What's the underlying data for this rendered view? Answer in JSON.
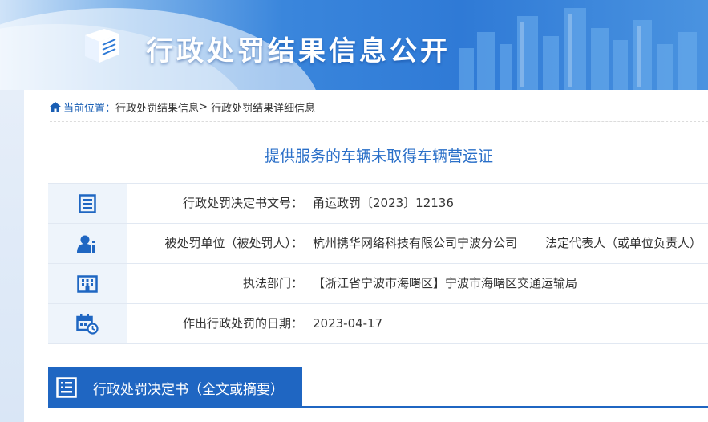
{
  "banner": {
    "title": "行政处罚结果信息公开"
  },
  "breadcrumb": {
    "label": "当前位置：",
    "items": [
      "行政处罚结果信息",
      "行政处罚结果详细信息"
    ],
    "separator": ">"
  },
  "page_title": "提供服务的车辆未取得车辆营运证",
  "rows": [
    {
      "icon": "document-icon",
      "label": "行政处罚决定书文号：",
      "value": "甬运政罚〔2023〕12136"
    },
    {
      "icon": "person-info-icon",
      "label": "被处罚单位（被处罚人）：",
      "value": "杭州携华网络科技有限公司宁波分公司",
      "extra": "法定代表人（或单位负责人）"
    },
    {
      "icon": "building-icon",
      "label": "执法部门：",
      "value": "【浙江省宁波市海曙区】宁波市海曙区交通运输局"
    },
    {
      "icon": "calendar-clock-icon",
      "label": "作出行政处罚的日期：",
      "value": "2023-04-17"
    }
  ],
  "section": {
    "title": "行政处罚决定书（全文或摘要）"
  },
  "colors": {
    "primary": "#1f66c2",
    "title": "#2a6fc8"
  }
}
